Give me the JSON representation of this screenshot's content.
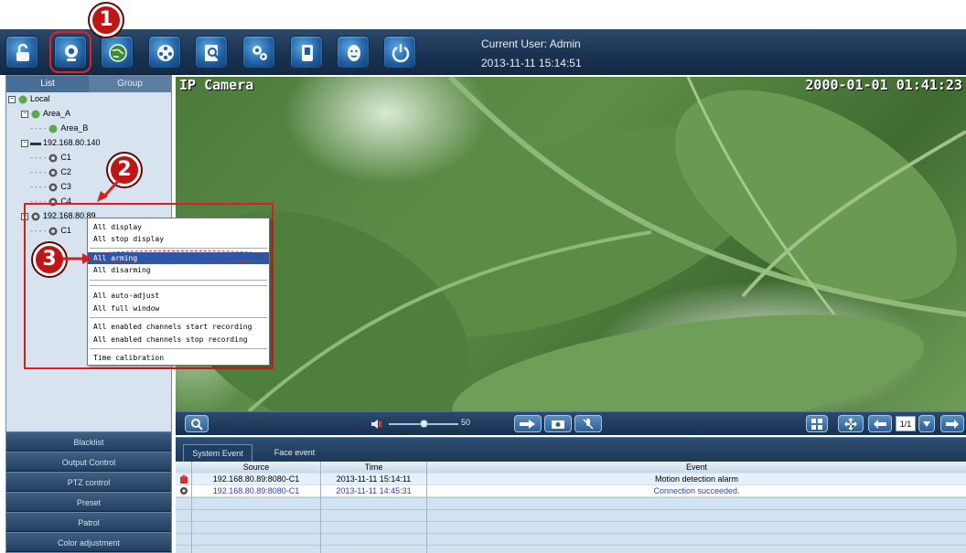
{
  "toolbar": {
    "buttons": [
      {
        "icon": "unlock-icon"
      },
      {
        "icon": "camera-icon"
      },
      {
        "icon": "map-icon"
      },
      {
        "icon": "film-reel-icon"
      },
      {
        "icon": "search-log-icon"
      },
      {
        "icon": "settings-icon"
      },
      {
        "icon": "device-icon"
      },
      {
        "icon": "face-icon"
      },
      {
        "icon": "power-icon"
      }
    ],
    "current_user": "Current User: Admin",
    "datetime": "2013-11-11 15:14:51"
  },
  "callouts": [
    "1",
    "2",
    "3"
  ],
  "left_panel": {
    "tabs": [
      "List",
      "Group"
    ],
    "tree": [
      {
        "label": "Local"
      },
      {
        "label": "Area_A"
      },
      {
        "label": "Area_B"
      },
      {
        "label": "192.168.80.140"
      },
      {
        "label": "C1"
      },
      {
        "label": "C2"
      },
      {
        "label": "C3"
      },
      {
        "label": "C4"
      },
      {
        "label": "192.168.80.89"
      },
      {
        "label": "C1"
      }
    ],
    "buttons": [
      "Blacklist",
      "Output Control",
      "PTZ control",
      "Preset",
      "Patrol",
      "Color adjustment"
    ]
  },
  "context_menu": {
    "items": [
      "All display",
      "All stop display",
      "All arming",
      "All disarming",
      "All auto-adjust",
      "All full window",
      "All enabled channels start recording",
      "All enabled channels stop recording",
      "Time calibration"
    ],
    "highlighted": "All arming"
  },
  "video": {
    "camera_label": "IP Camera",
    "timestamp": "2000-01-01 01:41:23"
  },
  "control_bar": {
    "volume": "50",
    "volume_level": 0.5,
    "page": "1/1"
  },
  "events": {
    "tabs": [
      "System Event",
      "Face event"
    ],
    "columns": [
      "Source",
      "Time",
      "Event"
    ],
    "rows": [
      {
        "source": "192.168.80.89:8080-C1",
        "time": "2013-11-11 15:14:11",
        "event": "Motion detection alarm"
      },
      {
        "source": "192.168.80.89:8080-C1",
        "time": "2013-11-11 14:45:31",
        "event": "Connection succeeded."
      }
    ]
  },
  "colors": {
    "accent": "#1f5d9e",
    "highlight": "#2d57a6",
    "callout": "#c01515",
    "event_link": "#2a3fcf"
  }
}
